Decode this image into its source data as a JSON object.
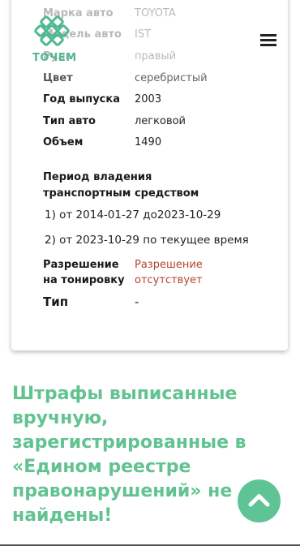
{
  "header": {
    "logo_text": "ТОЧЕМ",
    "menu_icon": "hamburger-menu-icon"
  },
  "vehicle": {
    "rows": [
      {
        "label": "Марка авто",
        "value": "TOYOTA"
      },
      {
        "label": "Модель авто",
        "value": "IST"
      },
      {
        "label": "Руль",
        "value": "правый"
      },
      {
        "label": "Цвет",
        "value": "серебристый"
      },
      {
        "label": "Год выпуска",
        "value": "2003"
      },
      {
        "label": "Тип авто",
        "value": "легковой"
      },
      {
        "label": "Объем",
        "value": "1490"
      }
    ],
    "ownership_title": "Период владения транспортным средством",
    "periods": [
      "1) от 2014-01-27 до2023-10-29",
      "2) от 2023-10-29 по текущее время"
    ],
    "tint_label": "Разрешение на тонировку",
    "tint_value": "Разрешение отсутствует",
    "type_label": "Тип",
    "type_value": "-"
  },
  "fines_message": "Штрафы выписанные вручную, зарегистрированные в «Едином реестре правонарушений» не найдены!",
  "scroll_top_icon": "chevron-up-icon",
  "colors": {
    "accent_green": "#5fc495",
    "warning_red": "#b2452b"
  }
}
